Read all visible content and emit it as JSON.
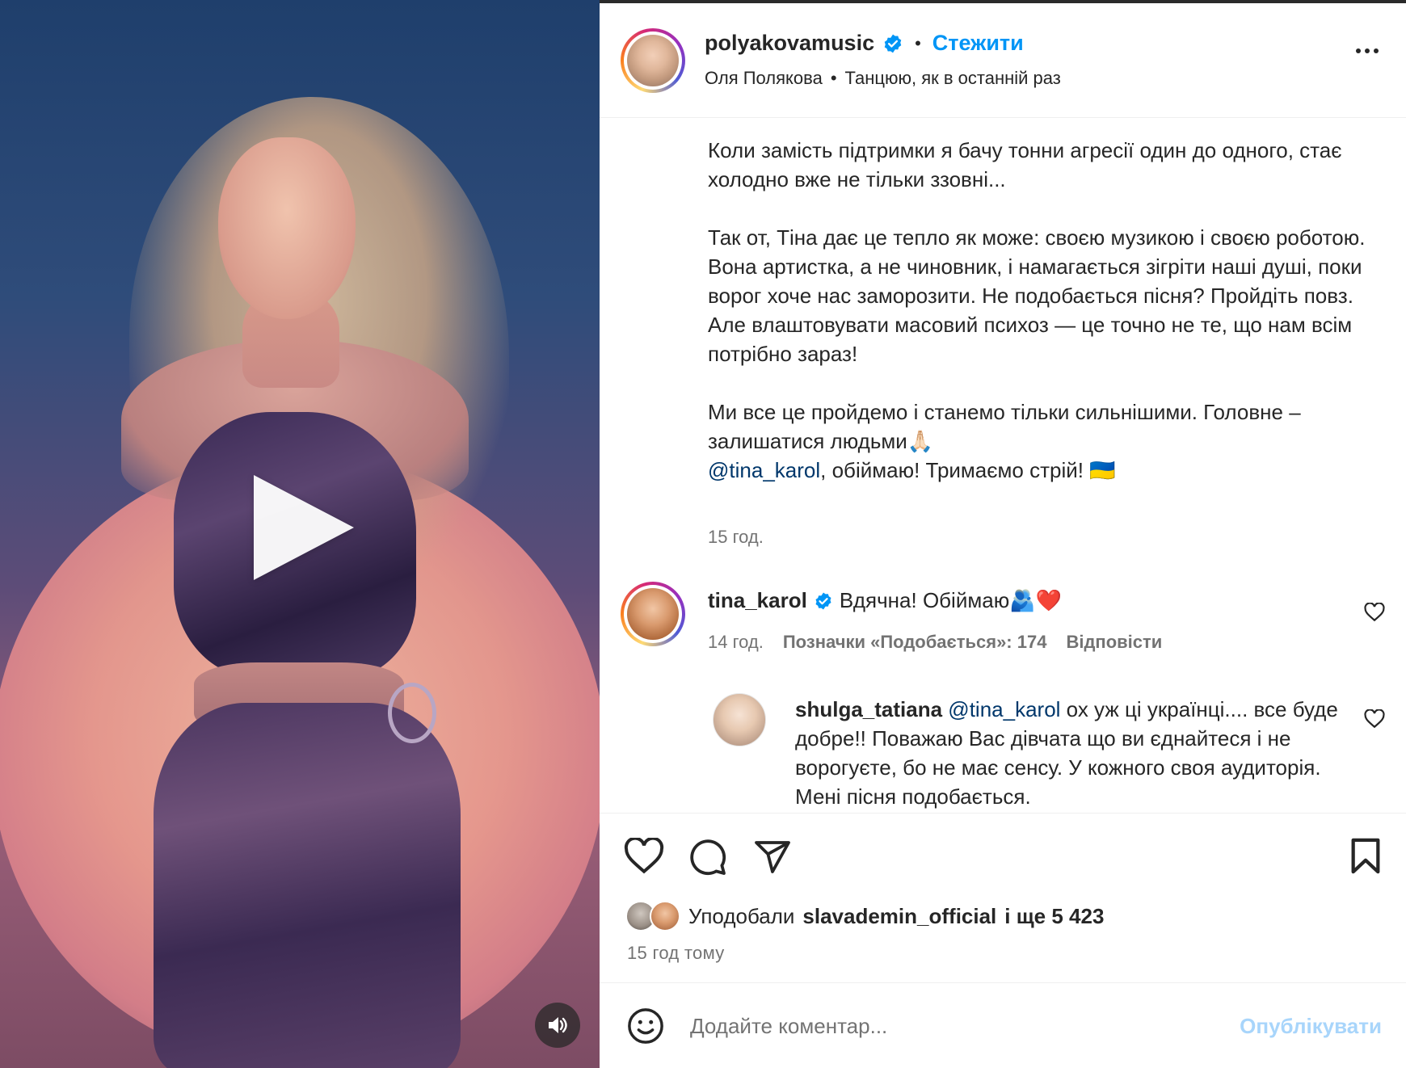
{
  "post": {
    "author": "polyakovamusic",
    "follow_label": "Стежити",
    "dot": "•",
    "subtitle_name": "Оля Полякова",
    "subtitle_song": "Танцюю, як в останній раз",
    "caption": {
      "p1": "Коли замість підтримки я бачу тонни агресії один до одного, стає холодно вже не тільки ззовні...",
      "p2": "Так от, Тіна дає це тепло як може: своєю музикою і своєю роботою. Вона артистка, а не чиновник, і намагається зігріти наші душі, поки ворог хоче нас заморозити. Не подобається пісня? Пройдіть повз. Але влаштовувати масовий психоз — це точно не те, що нам всім потрібно зараз!",
      "p3_line": "Ми все це пройдемо і станемо тільки сильнішими. Головне – залишатися людьми🙏🏻",
      "mention": "@tina_karol",
      "p3_tail": ", обіймаю! Тримаємо стрій! 🇺🇦"
    },
    "caption_time": "15 год."
  },
  "comments": [
    {
      "user": "tina_karol",
      "text": "Вдячна! Обіймаю🫂❤️",
      "time": "14 год.",
      "likes_label": "Позначки «Подобається»: 174",
      "reply_label": "Відповісти"
    },
    {
      "user": "shulga_tatiana",
      "mention": "@tina_karol",
      "text": " ох уж ці українці.... все буде добре!! Поважаю Вас дівчата що ви єднайтеся і не ворогуєте, бо не має сенсу. У кожного своя аудиторія. Мені пісня подобається."
    }
  ],
  "likes": {
    "prefix": "Уподобали",
    "user": "slavademin_official",
    "suffix": "і ще 5 423",
    "ago": "15 год тому"
  },
  "composer": {
    "placeholder": "Додайте коментар...",
    "publish_label": "Опублікувати"
  },
  "icons": [
    "play-icon",
    "volume-icon",
    "verified-icon",
    "more-icon",
    "heart-icon",
    "comment-icon",
    "share-icon",
    "bookmark-icon",
    "emoji-icon"
  ],
  "colors": {
    "accent": "#0095f6",
    "verified": "#0095f6",
    "mention": "#00376b",
    "secondary_text": "#737373",
    "publish_disabled": "#a8d5fb"
  }
}
